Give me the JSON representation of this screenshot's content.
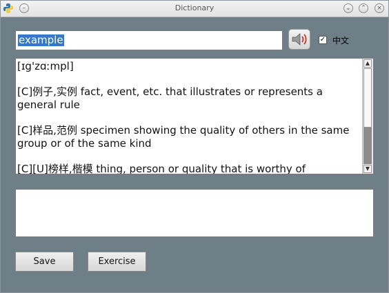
{
  "window": {
    "title": "Dictionary"
  },
  "search": {
    "value": "example"
  },
  "chinese_toggle": {
    "label": "中文",
    "checked": true,
    "check_mark": "✓"
  },
  "definition": {
    "lines": [
      "[ɪg'zɑːmpl]",
      "[C]例子,实例 fact, event, etc. that illustrates or represents a general rule",
      "[C]样品,范例 specimen showing the quality of others in the same group or of the same kind",
      "[C][U]榜样,楷模 thing, person or quality that is worthy of"
    ]
  },
  "buttons": {
    "save": "Save",
    "exercise": "Exercise"
  },
  "icons": {
    "app": "python-icon",
    "speaker": "speaker-icon",
    "minimize": "minimize-icon",
    "maximize": "maximize-icon",
    "close": "close-icon"
  }
}
